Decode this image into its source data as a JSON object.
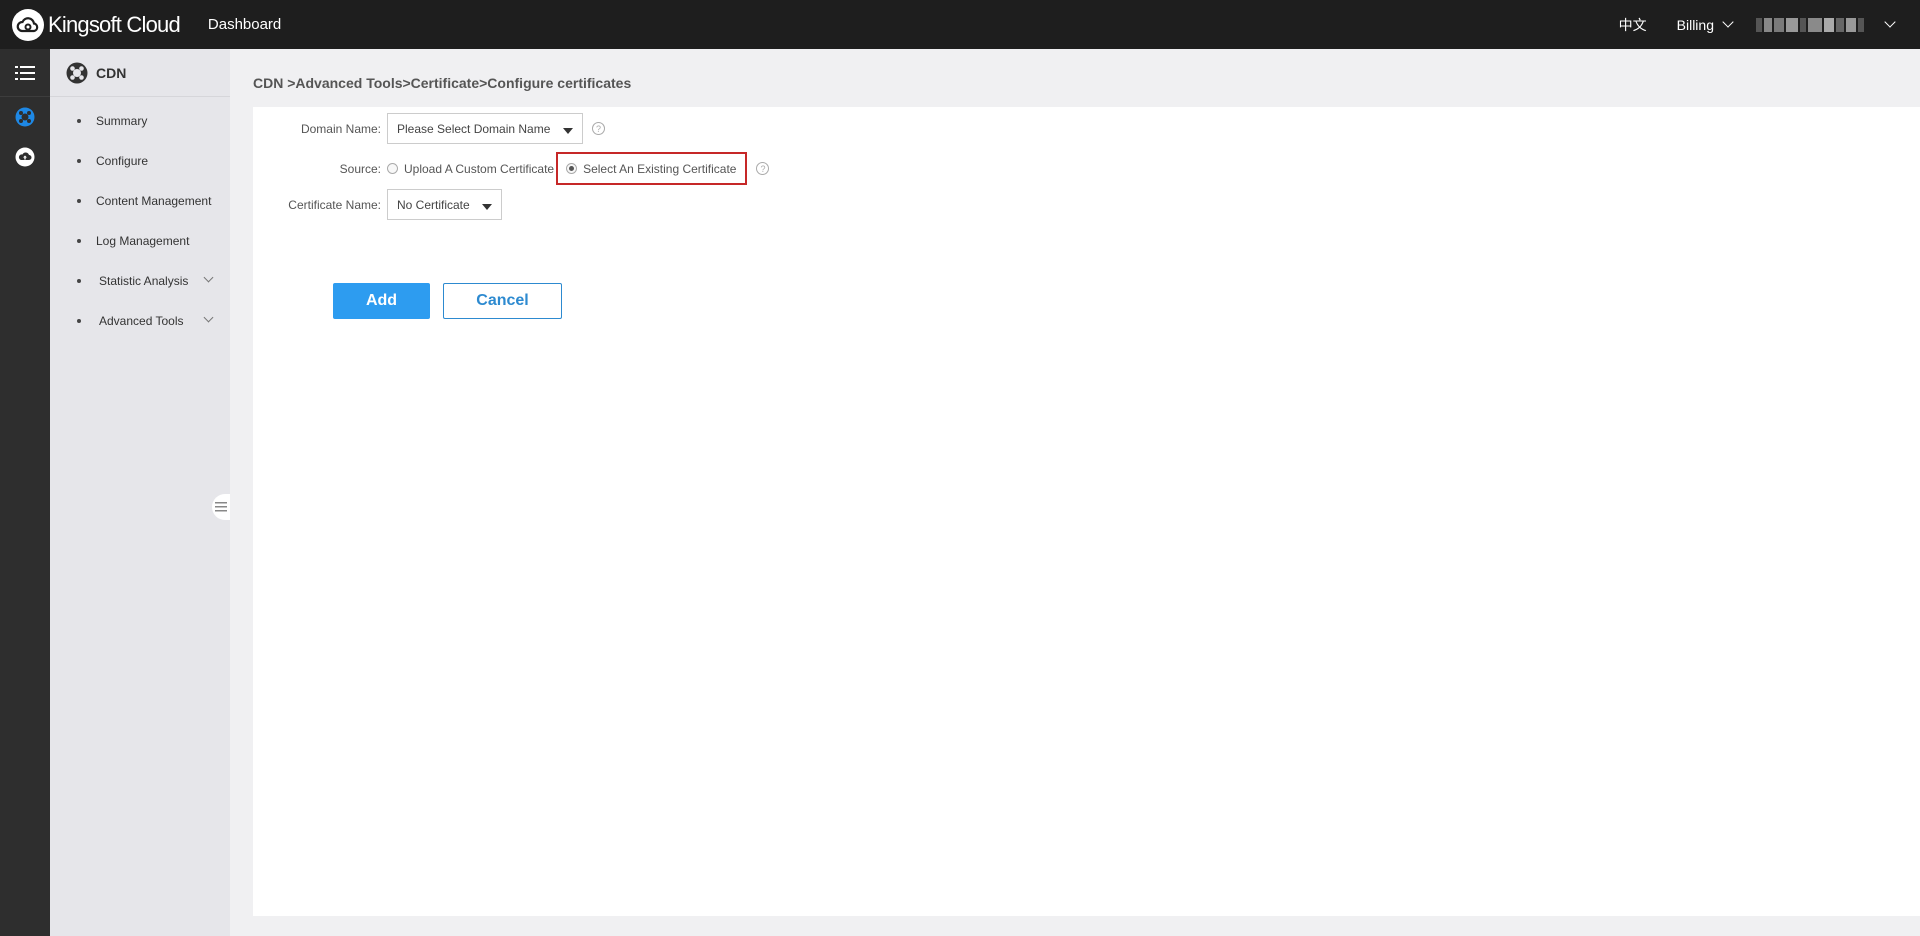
{
  "header": {
    "brand": "Kingsoft Cloud",
    "nav_dashboard": "Dashboard",
    "language": "中文",
    "billing": "Billing"
  },
  "sidebar": {
    "title": "CDN",
    "items": [
      {
        "label": "Summary"
      },
      {
        "label": "Configure"
      },
      {
        "label": "Content Management"
      },
      {
        "label": "Log Management"
      },
      {
        "label": "Statistic Analysis"
      },
      {
        "label": "Advanced Tools"
      }
    ]
  },
  "main": {
    "breadcrumb": "CDN >Advanced Tools>Certificate>Configure certificates",
    "form": {
      "domain_label": "Domain Name:",
      "domain_value": "Please Select Domain Name",
      "source_label": "Source:",
      "source_options": [
        {
          "label": "Upload A Custom Certificate",
          "selected": false
        },
        {
          "label": "Select An Existing Certificate",
          "selected": true
        }
      ],
      "cert_label": "Certificate Name:",
      "cert_value": "No Certificate",
      "help_glyph": "?"
    },
    "buttons": {
      "add": "Add",
      "cancel": "Cancel"
    }
  },
  "colors": {
    "topbar": "#1e1e1e",
    "primary": "#2d9cf0",
    "highlight_border": "#c62828",
    "active_icon": "#1e88e5"
  },
  "icons": [
    "cloud-logo-icon",
    "menu-list-icon",
    "cdn-icon",
    "cloud-upload-icon",
    "question-icon",
    "chevron-down-icon",
    "caret-down-icon",
    "collapse-handle-icon"
  ]
}
